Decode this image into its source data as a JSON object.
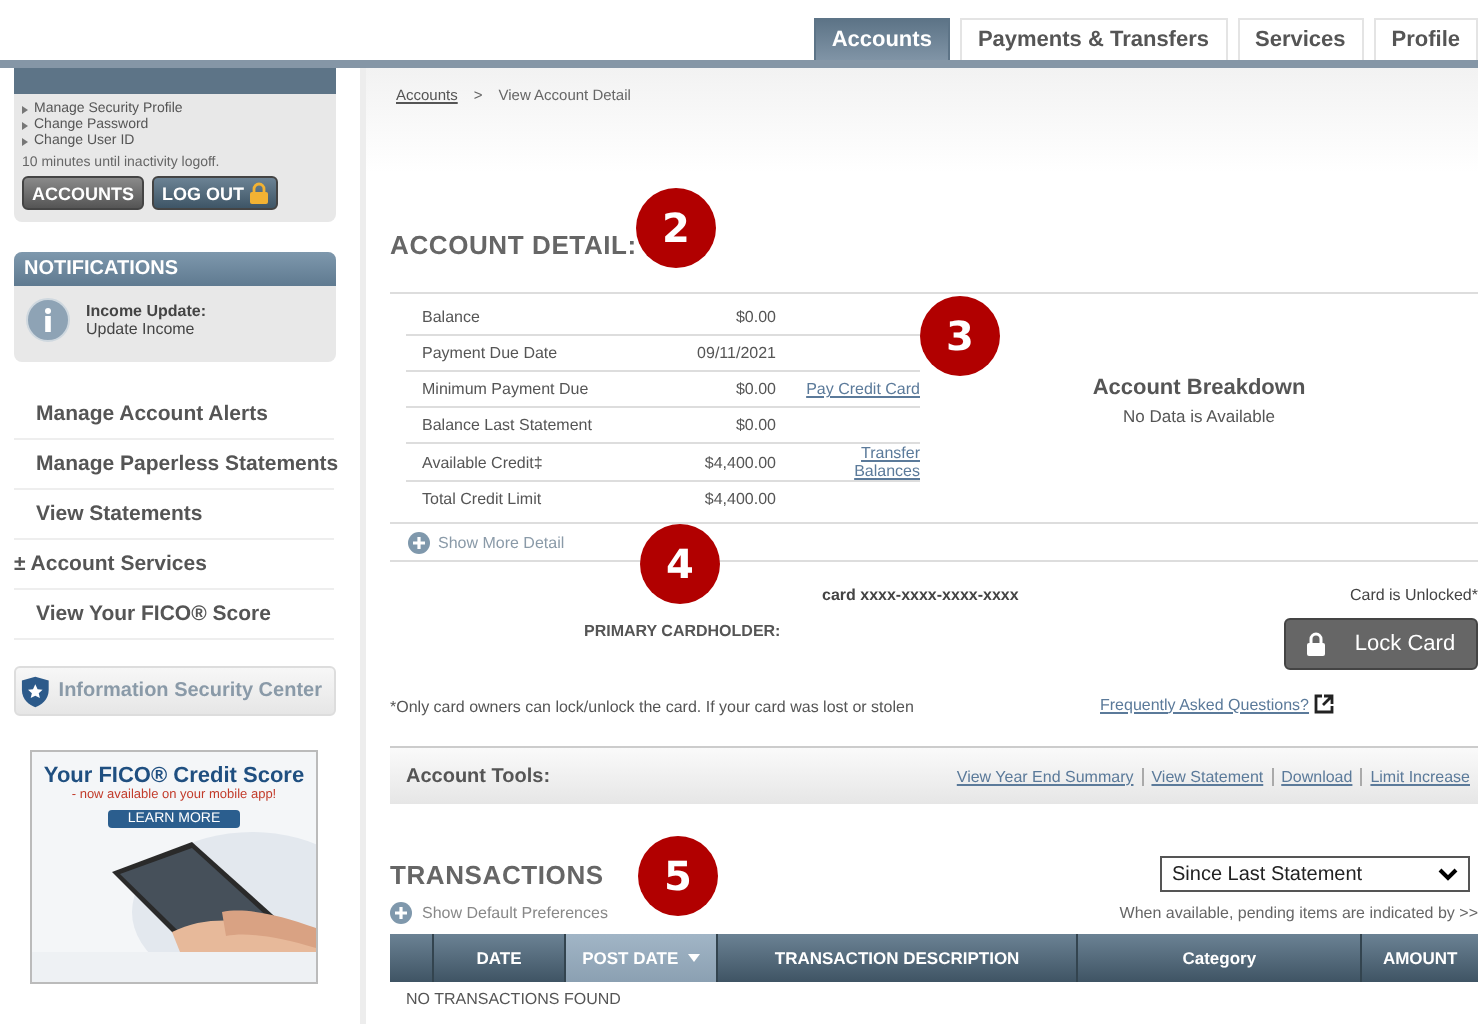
{
  "tabs": [
    {
      "label": "Accounts",
      "selected": true
    },
    {
      "label": "Payments & Transfers",
      "selected": false
    },
    {
      "label": "Services",
      "selected": false
    },
    {
      "label": "Profile",
      "selected": false
    }
  ],
  "sidebar": {
    "profile_links": [
      "Manage Security Profile",
      "Change Password",
      "Change User ID"
    ],
    "inactivity": "10 minutes until inactivity logoff.",
    "buttons": [
      {
        "label": "ACCOUNTS",
        "kind": "plain"
      },
      {
        "label": "LOG OUT",
        "kind": "lock"
      }
    ],
    "notifications": {
      "title": "NOTIFICATIONS",
      "heading": "Income Update:",
      "text": "Update Income"
    },
    "items": [
      {
        "label": "Manage Account Alerts"
      },
      {
        "label": "Manage Paperless Statements"
      },
      {
        "label": "View Statements"
      },
      {
        "label": "Account Services",
        "prefix": "±"
      },
      {
        "label": "View Your FICO® Score"
      }
    ],
    "security_button": "Information Security Center",
    "ad": {
      "title": "Your FICO® Credit Score",
      "subtitle": "- now available on your mobile app!",
      "button": "LEARN MORE"
    }
  },
  "breadcrumb": {
    "link": "Accounts",
    "separator": ">",
    "current": "View Account Detail"
  },
  "account_detail": {
    "title": "ACCOUNT DETAIL:",
    "marker": "2",
    "rows": [
      {
        "label": "Balance",
        "value": "$0.00"
      },
      {
        "label": "Payment Due Date",
        "value": "09/11/2021"
      },
      {
        "label": "Minimum Payment Due",
        "value": "$0.00",
        "link": "Pay Credit Card"
      },
      {
        "label": "Balance Last Statement",
        "value": "$0.00"
      },
      {
        "label": "Available Credit‡",
        "value": "$4,400.00",
        "link": "Transfer Balances"
      },
      {
        "label": "Total Credit Limit",
        "value": "$4,400.00"
      }
    ],
    "breakdown": {
      "title": "Account Breakdown",
      "text": "No Data is Available",
      "marker": "3"
    },
    "show_more": "Show More Detail"
  },
  "card": {
    "marker": "4",
    "number": "card xxxx-xxxx-xxxx-xxxx",
    "holder_label": "PRIMARY CARDHOLDER:",
    "status": "Card is Unlocked*",
    "button": "Lock Card",
    "disclaimer": "*Only card owners can lock/unlock the card. If your card was lost or stolen",
    "faq": "Frequently Asked Questions?"
  },
  "account_tools": {
    "title": "Account Tools:",
    "links": [
      "View Year End Summary",
      "View Statement",
      "Download",
      "Limit Increase"
    ]
  },
  "transactions": {
    "title": "TRANSACTIONS",
    "marker": "5",
    "period": "Since Last Statement",
    "show_defaults": "Show Default Preferences",
    "pending_note": "When available, pending items are indicated by >>",
    "columns": [
      {
        "label": "DATE",
        "selected": false
      },
      {
        "label": "POST DATE",
        "selected": true
      },
      {
        "label": "TRANSACTION DESCRIPTION",
        "selected": false
      },
      {
        "label": "Category",
        "selected": false
      },
      {
        "label": "AMOUNT",
        "selected": false
      }
    ],
    "empty": "NO TRANSACTIONS FOUND"
  }
}
